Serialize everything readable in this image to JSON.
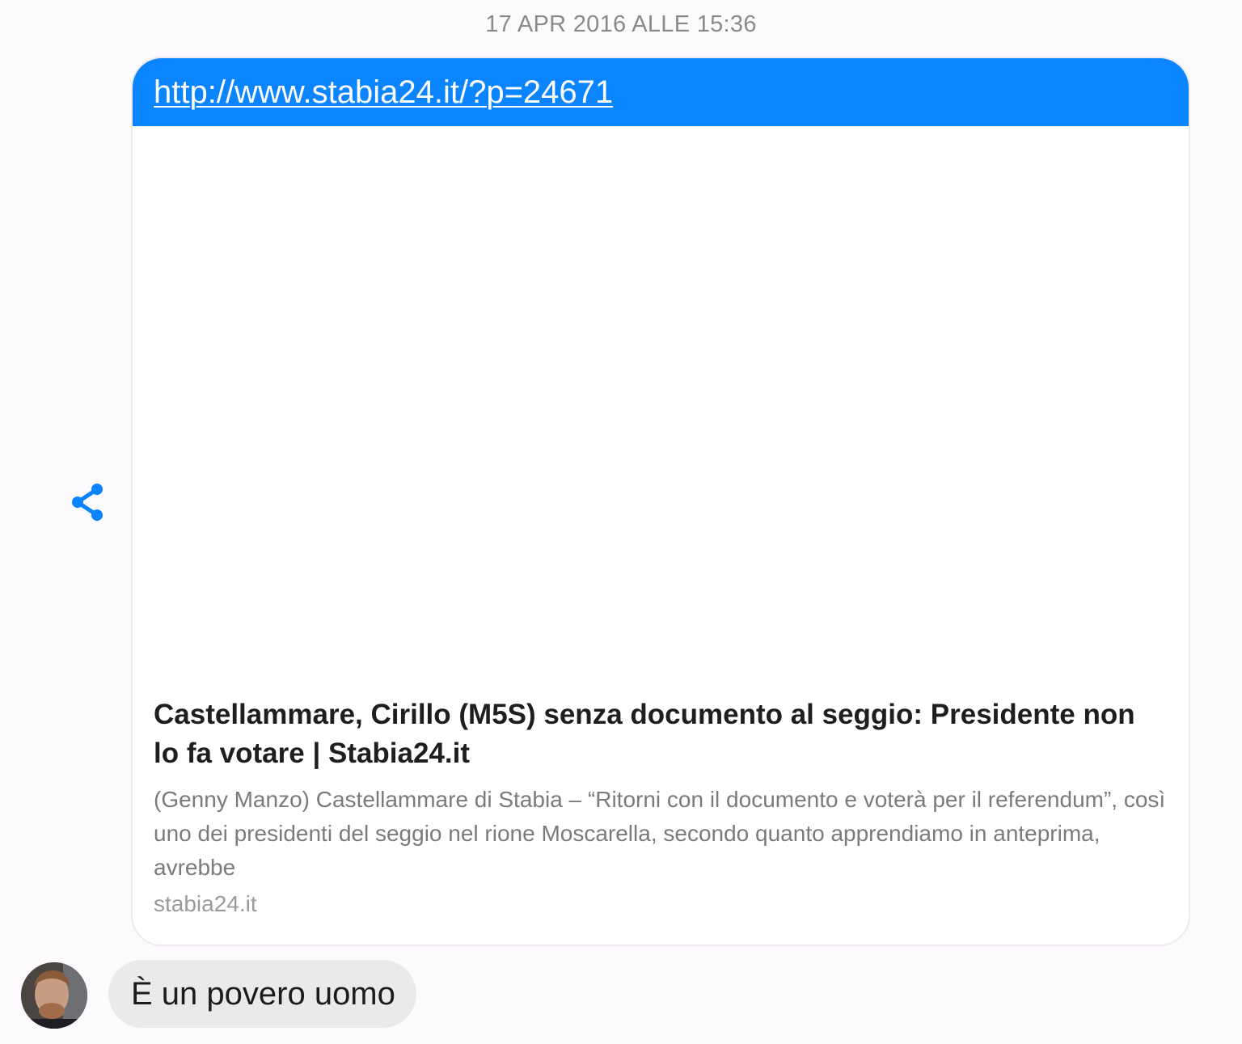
{
  "conversation": {
    "timestamp": "17 APR 2016 ALLE 15:36"
  },
  "shared_link": {
    "url": "http://www.stabia24.it/?p=24671",
    "title": "Castellammare, Cirillo (M5S) senza documento al seggio: Presidente non lo fa votare | Stabia24.it",
    "description": "(Genny Manzo) Castellammare di Stabia – “Ritorni con il documento e voterà per il referendum”, così uno dei presidenti del seggio nel rione Moscarella, secondo quanto apprendiamo in anteprima, avrebbe",
    "domain": "stabia24.it",
    "share_icon": "share-icon",
    "header_color": "#0a84ff"
  },
  "reply": {
    "text": "È un povero uomo",
    "avatar": "avatar-photo"
  }
}
